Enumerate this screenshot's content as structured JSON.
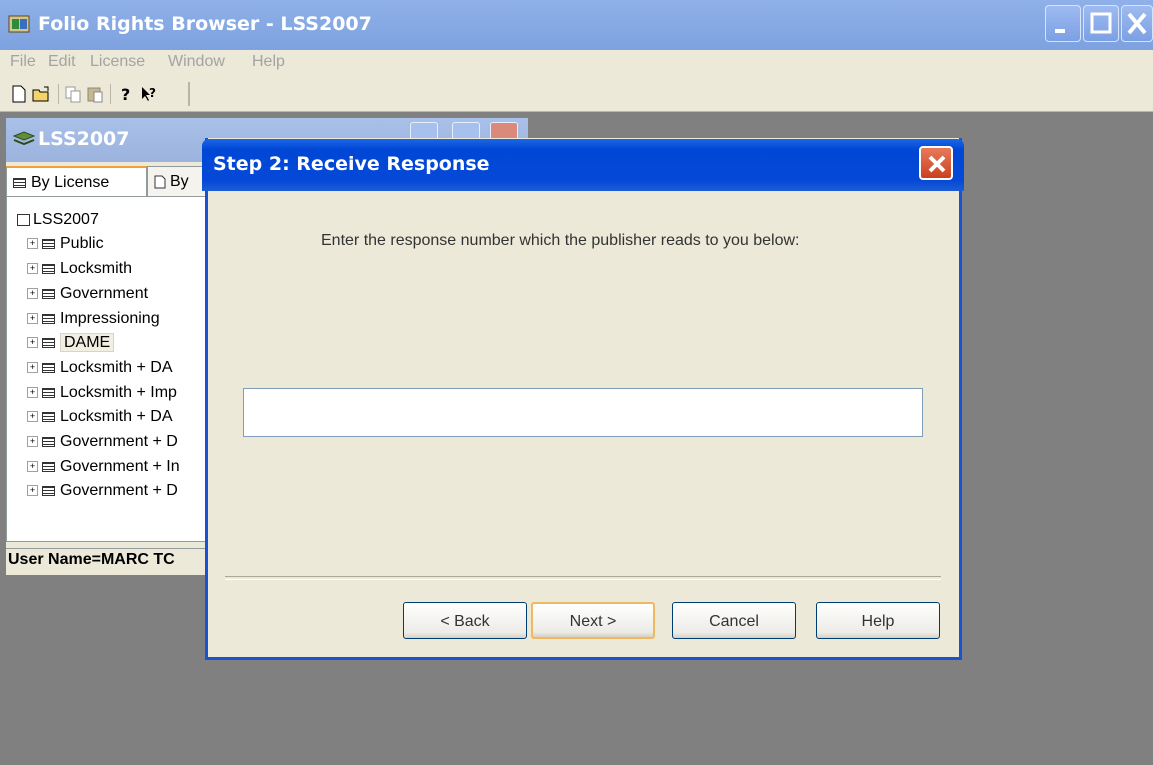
{
  "app": {
    "title": "Folio Rights Browser - LSS2007"
  },
  "menu": [
    "File",
    "Edit",
    "License",
    "Window",
    "Help"
  ],
  "child_window": {
    "title": "LSS2007",
    "tabs": [
      "By License",
      "By"
    ],
    "tree": {
      "root": "LSS2007",
      "items": [
        "Public",
        "Locksmith",
        "Government",
        "Impressioning",
        "DAME",
        "Locksmith + DA",
        "Locksmith + Imp",
        "Locksmith + DA",
        "Government + D",
        "Government + In",
        "Government + D"
      ],
      "selected": "DAME"
    },
    "status": "User Name=MARC TC"
  },
  "dialog": {
    "title": "Step 2: Receive Response",
    "instruction": "Enter the response number which the publisher reads to you below:",
    "response_value": "",
    "buttons": {
      "back": "< Back",
      "next": "Next >",
      "cancel": "Cancel",
      "help": "Help"
    }
  }
}
